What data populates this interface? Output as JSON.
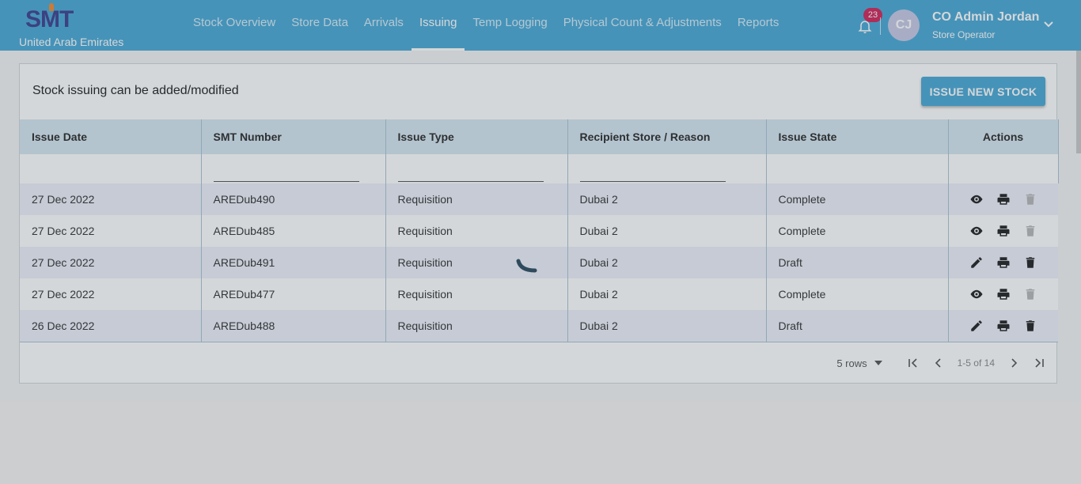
{
  "brand": {
    "logo_text": "SMT",
    "country": "United Arab Emirates"
  },
  "nav": {
    "items": [
      {
        "label": "Stock Overview"
      },
      {
        "label": "Store Data"
      },
      {
        "label": "Arrivals"
      },
      {
        "label": "Issuing"
      },
      {
        "label": "Temp Logging"
      },
      {
        "label": "Physical Count & Adjustments"
      },
      {
        "label": "Reports"
      }
    ],
    "active": "Issuing"
  },
  "notifications": {
    "count": "23",
    "icon": "bell-icon"
  },
  "user": {
    "initials": "CJ",
    "name": "CO Admin Jordan",
    "role": "Store Operator"
  },
  "page": {
    "subtitle": "Stock issuing can be added/modified",
    "new_button_label": "ISSUE NEW STOCK"
  },
  "table": {
    "columns": [
      "Issue Date",
      "SMT Number",
      "Issue Type",
      "Recipient Store / Reason",
      "Issue State",
      "Actions"
    ],
    "rows": [
      {
        "date": "27 Dec 2022",
        "smt": "AREDub490",
        "type": "Requisition",
        "recipient": "Dubai 2",
        "state": "Complete",
        "primary_action": "view-icon"
      },
      {
        "date": "27 Dec 2022",
        "smt": "AREDub485",
        "type": "Requisition",
        "recipient": "Dubai 2",
        "state": "Complete",
        "primary_action": "view-icon"
      },
      {
        "date": "27 Dec 2022",
        "smt": "AREDub491",
        "type": "Requisition",
        "recipient": "Dubai 2",
        "state": "Draft",
        "primary_action": "edit-icon"
      },
      {
        "date": "27 Dec 2022",
        "smt": "AREDub477",
        "type": "Requisition",
        "recipient": "Dubai 2",
        "state": "Complete",
        "primary_action": "view-icon"
      },
      {
        "date": "26 Dec 2022",
        "smt": "AREDub488",
        "type": "Requisition",
        "recipient": "Dubai 2",
        "state": "Draft",
        "primary_action": "edit-icon"
      }
    ]
  },
  "pagination": {
    "rows_per_page": "5 rows",
    "range": "1-5 of 14"
  },
  "colors": {
    "header": "#4aa8d6",
    "badge": "#d0265a",
    "table_header": "#d7e7f1",
    "logo": "#3d3f8f"
  }
}
